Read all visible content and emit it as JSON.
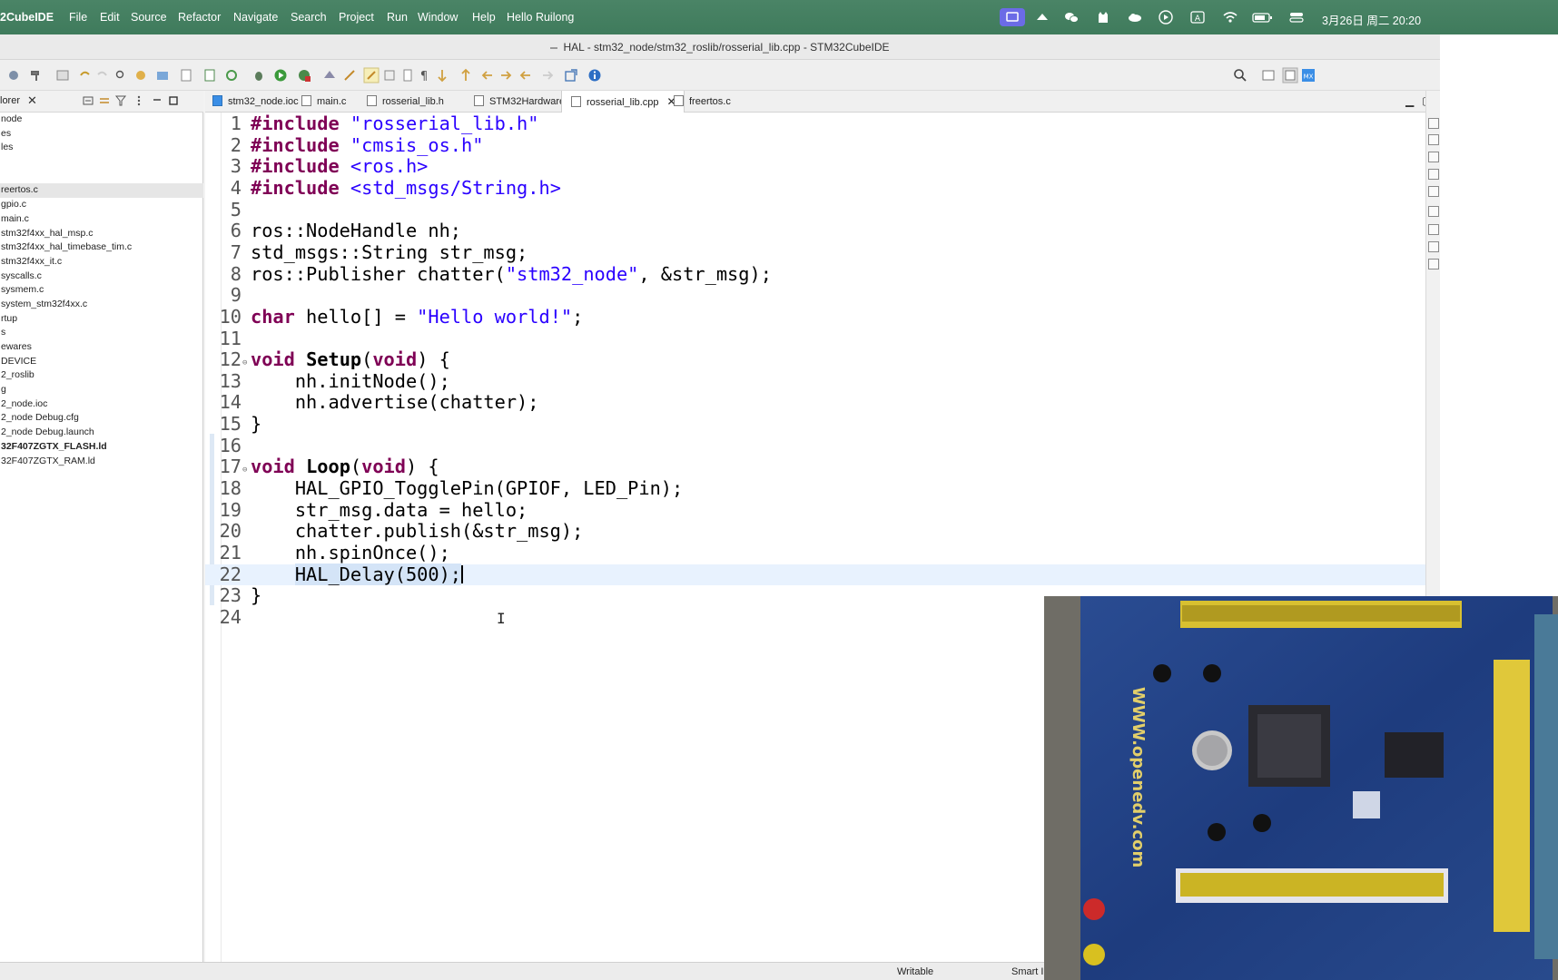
{
  "menubar": {
    "app_name": "2CubeIDE",
    "menus": [
      "File",
      "Edit",
      "Source",
      "Refactor",
      "Navigate",
      "Search",
      "Project",
      "Run",
      "Window",
      "Help",
      "Hello Ruilong"
    ],
    "clock": "3月26日 周二  20:20",
    "tray_icons": [
      "screen-mirror-icon",
      "bird-icon",
      "wechat-icon",
      "cat-icon",
      "cloud-icon",
      "play-icon",
      "input-method-icon",
      "wifi-icon",
      "battery-icon",
      "control-center-icon"
    ]
  },
  "window": {
    "title": "HAL - stm32_node/stm32_roslib/rosserial_lib.cpp - STM32CubeIDE"
  },
  "explorer": {
    "title": "lorer",
    "items": [
      {
        "label": "node",
        "selected": false,
        "bold": false
      },
      {
        "label": "es",
        "selected": false,
        "bold": false
      },
      {
        "label": "les",
        "selected": false,
        "bold": false
      },
      {
        "label": "",
        "selected": false,
        "bold": false
      },
      {
        "label": "",
        "selected": false,
        "bold": false
      },
      {
        "label": "reertos.c",
        "selected": true,
        "bold": false
      },
      {
        "label": "gpio.c",
        "selected": false,
        "bold": false
      },
      {
        "label": "main.c",
        "selected": false,
        "bold": false
      },
      {
        "label": "stm32f4xx_hal_msp.c",
        "selected": false,
        "bold": false
      },
      {
        "label": "stm32f4xx_hal_timebase_tim.c",
        "selected": false,
        "bold": false
      },
      {
        "label": "stm32f4xx_it.c",
        "selected": false,
        "bold": false
      },
      {
        "label": "syscalls.c",
        "selected": false,
        "bold": false
      },
      {
        "label": "sysmem.c",
        "selected": false,
        "bold": false
      },
      {
        "label": "system_stm32f4xx.c",
        "selected": false,
        "bold": false
      },
      {
        "label": "rtup",
        "selected": false,
        "bold": false
      },
      {
        "label": "s",
        "selected": false,
        "bold": false
      },
      {
        "label": "ewares",
        "selected": false,
        "bold": false
      },
      {
        "label": "DEVICE",
        "selected": false,
        "bold": false
      },
      {
        "label": "2_roslib",
        "selected": false,
        "bold": false
      },
      {
        "label": "g",
        "selected": false,
        "bold": false
      },
      {
        "label": "2_node.ioc",
        "selected": false,
        "bold": false
      },
      {
        "label": "2_node Debug.cfg",
        "selected": false,
        "bold": false
      },
      {
        "label": "2_node Debug.launch",
        "selected": false,
        "bold": false
      },
      {
        "label": "32F407ZGTX_FLASH.ld",
        "selected": false,
        "bold": true
      },
      {
        "label": "32F407ZGTX_RAM.ld",
        "selected": false,
        "bold": false
      }
    ]
  },
  "editor": {
    "tabs": [
      {
        "label": "stm32_node.ioc",
        "icon": "mx-file-icon",
        "active": false
      },
      {
        "label": "main.c",
        "icon": "c-file-icon",
        "active": false
      },
      {
        "label": "rosserial_lib.h",
        "icon": "h-file-icon",
        "active": false
      },
      {
        "label": "STM32Hardware.h",
        "icon": "h-file-icon",
        "active": false
      },
      {
        "label": "rosserial_lib.cpp",
        "icon": "cpp-file-icon",
        "active": true
      },
      {
        "label": "freertos.c",
        "icon": "c-file-icon",
        "active": false
      }
    ],
    "lines": [
      {
        "n": "1",
        "code": [
          {
            "t": "#include",
            "k": "kw"
          },
          {
            "t": " "
          },
          {
            "t": "\"rosserial_lib.h\"",
            "k": "str"
          }
        ]
      },
      {
        "n": "2",
        "code": [
          {
            "t": "#include",
            "k": "kw"
          },
          {
            "t": " "
          },
          {
            "t": "\"cmsis_os.h\"",
            "k": "str"
          }
        ]
      },
      {
        "n": "3",
        "code": [
          {
            "t": "#include",
            "k": "kw"
          },
          {
            "t": " "
          },
          {
            "t": "<ros.h>",
            "k": "str"
          }
        ]
      },
      {
        "n": "4",
        "code": [
          {
            "t": "#include",
            "k": "kw"
          },
          {
            "t": " "
          },
          {
            "t": "<std_msgs/String.h>",
            "k": "str"
          }
        ]
      },
      {
        "n": "5",
        "code": []
      },
      {
        "n": "6",
        "code": [
          {
            "t": "ros::NodeHandle nh;"
          }
        ]
      },
      {
        "n": "7",
        "code": [
          {
            "t": "std_msgs::String str_msg;"
          }
        ]
      },
      {
        "n": "8",
        "code": [
          {
            "t": "ros::Publisher chatter("
          },
          {
            "t": "\"stm32_node\"",
            "k": "str"
          },
          {
            "t": ", &str_msg);"
          }
        ]
      },
      {
        "n": "9",
        "code": []
      },
      {
        "n": "10",
        "code": [
          {
            "t": "char",
            "k": "kw"
          },
          {
            "t": " hello[] = "
          },
          {
            "t": "\"Hello world!\"",
            "k": "str"
          },
          {
            "t": ";"
          }
        ]
      },
      {
        "n": "11",
        "code": []
      },
      {
        "n": "12",
        "fold": true,
        "code": [
          {
            "t": "void",
            "k": "kw"
          },
          {
            "t": " "
          },
          {
            "t": "Setup",
            "k": "fnb"
          },
          {
            "t": "("
          },
          {
            "t": "void",
            "k": "kw"
          },
          {
            "t": ") {"
          }
        ]
      },
      {
        "n": "13",
        "code": [
          {
            "t": "    nh.initNode();"
          }
        ]
      },
      {
        "n": "14",
        "code": [
          {
            "t": "    nh.advertise(chatter);"
          }
        ]
      },
      {
        "n": "15",
        "code": [
          {
            "t": "}"
          }
        ]
      },
      {
        "n": "16",
        "code": []
      },
      {
        "n": "17",
        "fold": true,
        "code": [
          {
            "t": "void",
            "k": "kw"
          },
          {
            "t": " "
          },
          {
            "t": "Loop",
            "k": "fnb"
          },
          {
            "t": "("
          },
          {
            "t": "void",
            "k": "kw"
          },
          {
            "t": ") {"
          }
        ]
      },
      {
        "n": "18",
        "code": [
          {
            "t": "    HAL_GPIO_TogglePin(GPIOF, LED_Pin);"
          }
        ]
      },
      {
        "n": "19",
        "code": [
          {
            "t": "    str_msg.data = hello;"
          }
        ]
      },
      {
        "n": "20",
        "code": [
          {
            "t": "    chatter.publish(&str_msg);"
          }
        ]
      },
      {
        "n": "21",
        "code": [
          {
            "t": "    nh.spinOnce();"
          }
        ]
      },
      {
        "n": "22",
        "current": true,
        "code": [
          {
            "t": "    "
          },
          {
            "t": "HAL_Delay(500);",
            "k": "sel-bg"
          },
          {
            "caret": true
          }
        ]
      },
      {
        "n": "23",
        "code": [
          {
            "t": "}"
          }
        ]
      },
      {
        "n": "24",
        "code": []
      }
    ]
  },
  "statusbar": {
    "mode": "Writable",
    "insert": "Smart Inse"
  },
  "overlay": {
    "board_text": "WWW.openedv.com"
  }
}
